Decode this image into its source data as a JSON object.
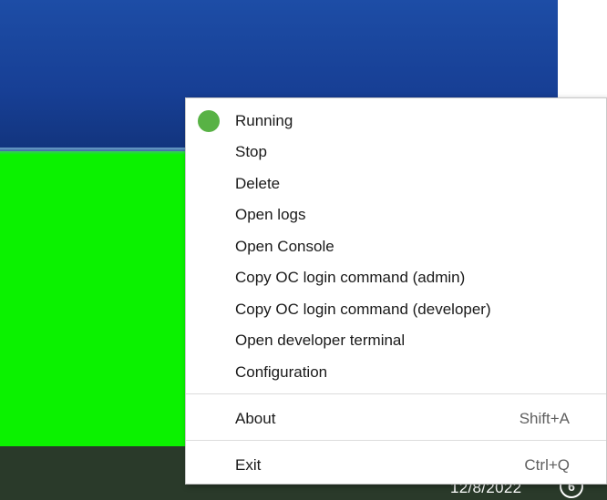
{
  "taskbar": {
    "date": "12/8/2022",
    "notification_count": "6"
  },
  "menu": {
    "status": {
      "label": "Running",
      "color": "#58b245"
    },
    "items": [
      {
        "label": "Stop"
      },
      {
        "label": "Delete"
      },
      {
        "label": "Open logs"
      },
      {
        "label": "Open Console"
      },
      {
        "label": "Copy OC login command (admin)"
      },
      {
        "label": "Copy OC login command (developer)"
      },
      {
        "label": "Open developer terminal"
      },
      {
        "label": "Configuration"
      }
    ],
    "about": {
      "label": "About",
      "shortcut": "Shift+A"
    },
    "exit": {
      "label": "Exit",
      "shortcut": "Ctrl+Q"
    }
  }
}
